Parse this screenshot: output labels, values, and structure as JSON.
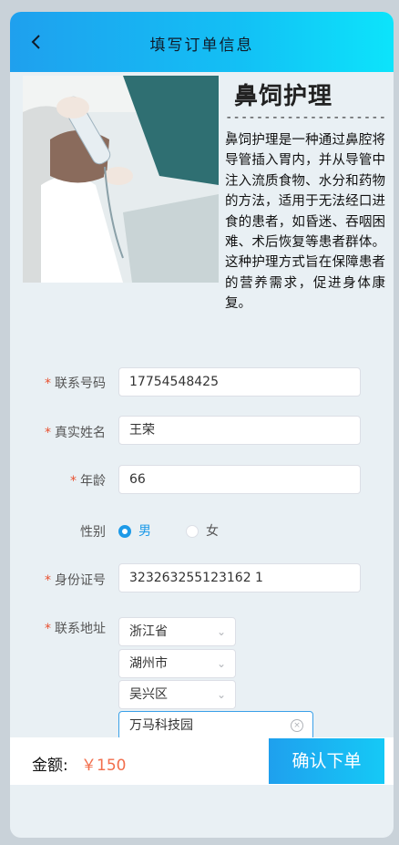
{
  "header": {
    "title": "填写订单信息"
  },
  "service": {
    "title": "鼻饲护理",
    "separator": "----------------------",
    "description": "鼻饲护理是一种通过鼻腔将导管插入胃内，并从导管中注入流质食物、水分和药物的方法，适用于无法经口进食的患者，如昏迷、吞咽困难、术后恢复等患者群体。这种护理方式旨在保障患者的营养需求，促进身体康复。"
  },
  "form": {
    "required_mark": "*",
    "phone": {
      "label": "联系号码",
      "value": "17754548425"
    },
    "name": {
      "label": "真实姓名",
      "value": "王荣"
    },
    "age": {
      "label": "年龄",
      "value": "66"
    },
    "gender": {
      "label": "性别",
      "options": [
        "男",
        "女"
      ],
      "selected": "男"
    },
    "id_card": {
      "label": "身份证号",
      "value": "323263255123162 1"
    },
    "address": {
      "label": "联系地址",
      "province": "浙江省",
      "city": "湖州市",
      "district": "吴兴区",
      "detail": "万马科技园"
    }
  },
  "footer": {
    "amount_label": "金额:",
    "amount_value": "￥150",
    "confirm_label": "确认下单"
  },
  "colors": {
    "accent": "#1d9ae8",
    "price": "#f26e4c",
    "required": "#e8502f"
  }
}
